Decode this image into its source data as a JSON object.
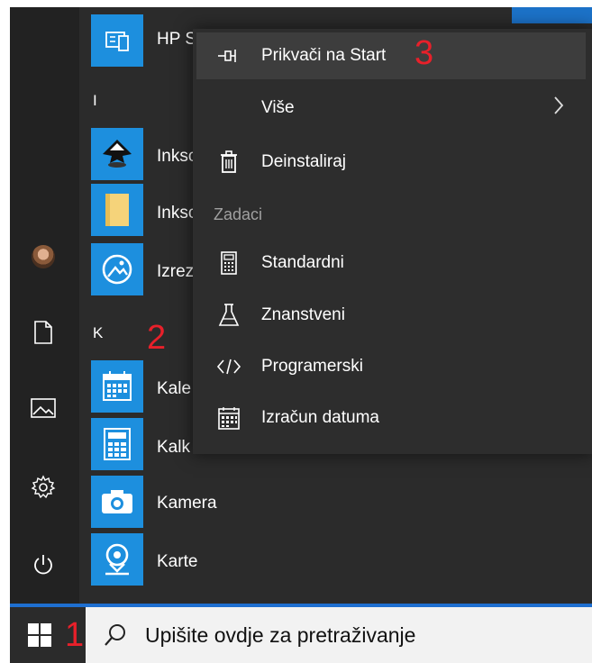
{
  "start_menu": {
    "apps": [
      {
        "label": "HP S",
        "icon": "hp-support-icon",
        "color": "#1d8fde"
      },
      {
        "label": "Inksc",
        "icon": "inkscape-icon",
        "color": "#1d8fde"
      },
      {
        "label": "Inksc",
        "icon": "folder-icon",
        "color": "#1d8fde"
      },
      {
        "label": "Izrez",
        "icon": "snip-sketch-icon",
        "color": "#1d8fde"
      },
      {
        "label": "Kale",
        "icon": "calendar-icon",
        "color": "#1d8fde"
      },
      {
        "label": "Kalk",
        "icon": "calculator-icon",
        "color": "#1d8fde"
      },
      {
        "label": "Kamera",
        "icon": "camera-icon",
        "color": "#1d8fde"
      },
      {
        "label": "Karte",
        "icon": "maps-icon",
        "color": "#1d8fde"
      }
    ],
    "section_letters": [
      "I",
      "K"
    ]
  },
  "context_menu": {
    "items": {
      "pin": "Prikvači na Start",
      "more": "Više",
      "uninstall": "Deinstaliraj"
    },
    "section": "Zadaci",
    "tasks": {
      "standard": "Standardni",
      "scientific": "Znanstveni",
      "programmer": "Programerski",
      "date": "Izračun datuma"
    }
  },
  "annotations": [
    "1",
    "2",
    "3"
  ],
  "taskbar": {
    "search_placeholder": "Upišite ovdje za pretraživanje"
  },
  "colors": {
    "accent": "#1d8fde",
    "annotation": "#e8202a",
    "menu_bg": "#2d2d2d"
  }
}
